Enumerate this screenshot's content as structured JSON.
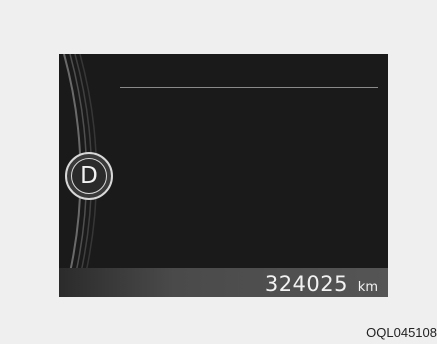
{
  "cluster": {
    "gear": "D",
    "odometer": {
      "value": "324025",
      "unit": "km"
    }
  },
  "figure_code": "OQL045108"
}
